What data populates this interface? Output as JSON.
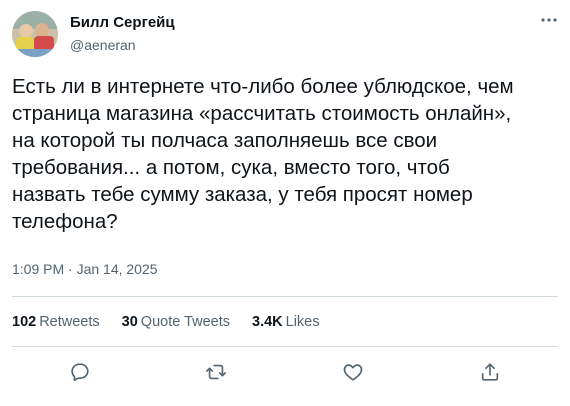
{
  "author": {
    "display_name": "Билл Сергейц",
    "handle": "@aeneran",
    "avatar_icon": "avatar-photo"
  },
  "more_icon": "more-dots-icon",
  "tweet": {
    "lines": [
      "Есть ли в интернете что-либо более ублюдское, чем",
      "страница магазина «рассчитать стоимость онлайн»,",
      "на которой ты полчаса заполняешь все свои",
      "требования... а потом, сука, вместо того, чтоб",
      "назвать тебе сумму заказа, у тебя просят номер",
      "телефона?"
    ],
    "timestamp": "1:09 PM · Jan 14, 2025"
  },
  "stats": {
    "retweets": {
      "count": "102",
      "label": "Retweets"
    },
    "quotes": {
      "count": "30",
      "label": "Quote Tweets"
    },
    "likes": {
      "count": "3.4K",
      "label": "Likes"
    }
  },
  "actions": [
    "reply-icon",
    "retweet-icon",
    "like-icon",
    "share-icon"
  ],
  "colors": {
    "text": "#0f1419",
    "secondary": "#536471",
    "divider": "#cfd9de"
  }
}
